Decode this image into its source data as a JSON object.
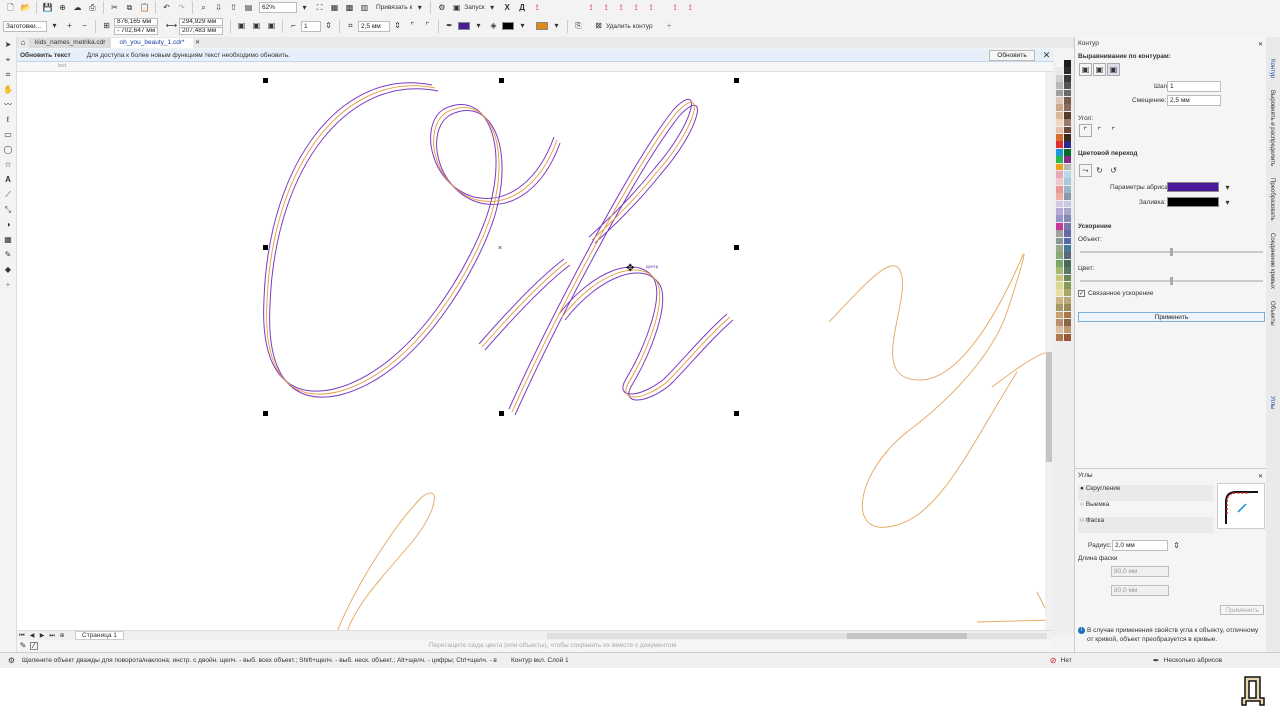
{
  "toolbar": {
    "zoom": "62%",
    "snap_label": "Привязать к",
    "launch_label": "Запуск",
    "preset": "Заготовки...",
    "x_pos": "876,165 мм",
    "y_pos": "- 702,647 мм",
    "width": "294,929 мм",
    "height": "207,483 мм",
    "count": "1",
    "thickness": "2,5 мм",
    "delete_contour": "Удалить контур"
  },
  "doc_tabs": [
    "kids_names_metrika.cdr",
    "oh_you_beauty_1.cdr*"
  ],
  "notice": {
    "title": "Обновить текст",
    "text": "Для доступа к более новым функциям текст необходимо обновить.",
    "button": "Обновить"
  },
  "ruler_labels": [
    "text"
  ],
  "page_nav": {
    "page_label": "Страница 1"
  },
  "canvas_hint": "Перетащите сюда цвета (или объекты), чтобы сохранить их вместе с документом",
  "handle_label": "центр",
  "contour_docker": {
    "title": "Контур",
    "align_label": "Выравнивание по контурам:",
    "steps_label": "Шаги:",
    "steps_value": "1",
    "offset_label": "Смещение:",
    "offset_value": "2,5 мм",
    "corner_label": "Угол:",
    "color_transition": "Цветовой переход",
    "outline_params": "Параметры абриса:",
    "fill_label": "Заливка:",
    "outline_color": "#4a1a9a",
    "fill_color": "#000000",
    "accel_label": "Ускорение",
    "object_label": "Объект:",
    "color_label": "Цвет:",
    "linked_accel": "Связанное ускорение",
    "apply": "Применить"
  },
  "corners_docker": {
    "title": "Углы",
    "options": [
      "Скругление",
      "Выемка",
      "Фаска"
    ],
    "radius_label": "Радиус:",
    "radius_value": "2,0 мм",
    "chamfer_label": "Длина фаски",
    "chamfer_val1": "80,0 мм",
    "chamfer_val2": "80,0 мм",
    "apply": "Применить",
    "info": "В случае применения свойств угла к объекту, отличному от кривой, объект преобразуется в кривые."
  },
  "side_tabs": [
    "Контур",
    "Выровнять и распределить",
    "Преобразовать",
    "Соединение кривых",
    "Объекты",
    "Углы"
  ],
  "status": {
    "hint": "Щелкните объект дважды для поворота/наклона; инстр. с двойн. щелч. - выб. всех объект.; Shift+щелч. - выб. неск. объект.; Alt+щелч. - цифры; Ctrl+щелч. - выб. в группе",
    "layer": "Контур вкл. Слой 1",
    "fill_none": "Нет",
    "outline_info": "Несколько абрисов"
  },
  "palette_colors": [
    "#f5f5f5",
    "#1a1a1a",
    "#e8e8e8",
    "#2a2a2a",
    "#cfcfcf",
    "#3a3a3a",
    "#b8b8b8",
    "#555555",
    "#a0a0a0",
    "#6a6a6a",
    "#e0c8b8",
    "#7a5a4a",
    "#c8a888",
    "#8a6a5a",
    "#d8b898",
    "#5a3a2a",
    "#f0d8c0",
    "#9a7a6a",
    "#e8c0a8",
    "#6a4a3a",
    "#d86a2a",
    "#3a2a1a",
    "#e03030",
    "#2a2a8a",
    "#1a9ad8",
    "#0a6a2a",
    "#2ab84a",
    "#8a2a8a",
    "#f0a020",
    "#b8b8b8",
    "#e8a8b8",
    "#b8d8e8",
    "#f0c8d0",
    "#a8c8d8",
    "#e89898",
    "#98b8c8",
    "#f0b0a0",
    "#8898a8",
    "#d8c8e8",
    "#c8c8e0",
    "#b8a8d8",
    "#a8a8c8",
    "#9898c8",
    "#8888b8",
    "#c83898",
    "#7878a8",
    "#a0a0a0",
    "#6868a8",
    "#889898",
    "#5868a8",
    "#98a888",
    "#487898",
    "#88a878",
    "#586878",
    "#78a868",
    "#486858",
    "#a8b870",
    "#587868",
    "#c8c878",
    "#6a8858",
    "#d8d890",
    "#889858",
    "#e8e0a0",
    "#a8a868",
    "#c8b880",
    "#b8a878",
    "#a89868",
    "#988858",
    "#c8a070",
    "#a87848",
    "#b89070",
    "#886848",
    "#d8c0a0",
    "#c09870",
    "#b07850",
    "#985838"
  ]
}
